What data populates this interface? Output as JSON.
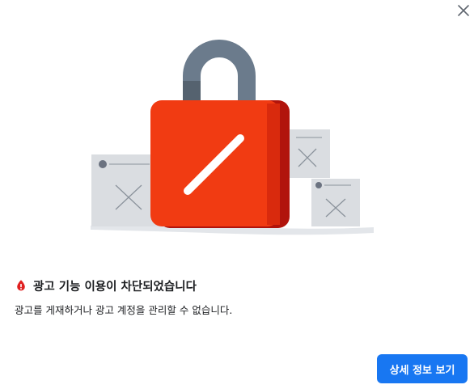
{
  "dialog": {
    "close_icon": "close-icon",
    "illustration_icon": "lock-icon",
    "alert_icon": "alert-icon",
    "title": "광고 기능 이용이 차단되었습니다",
    "body": "광고를 게재하거나 광고 계정을 관리할 수 없습니다.",
    "primary_button_label": "상세 정보 보기"
  },
  "colors": {
    "lock_body": "#f13b12",
    "lock_shackle": "#6b7b8c",
    "alert_icon": "#e02020",
    "primary_button": "#1877f2"
  }
}
